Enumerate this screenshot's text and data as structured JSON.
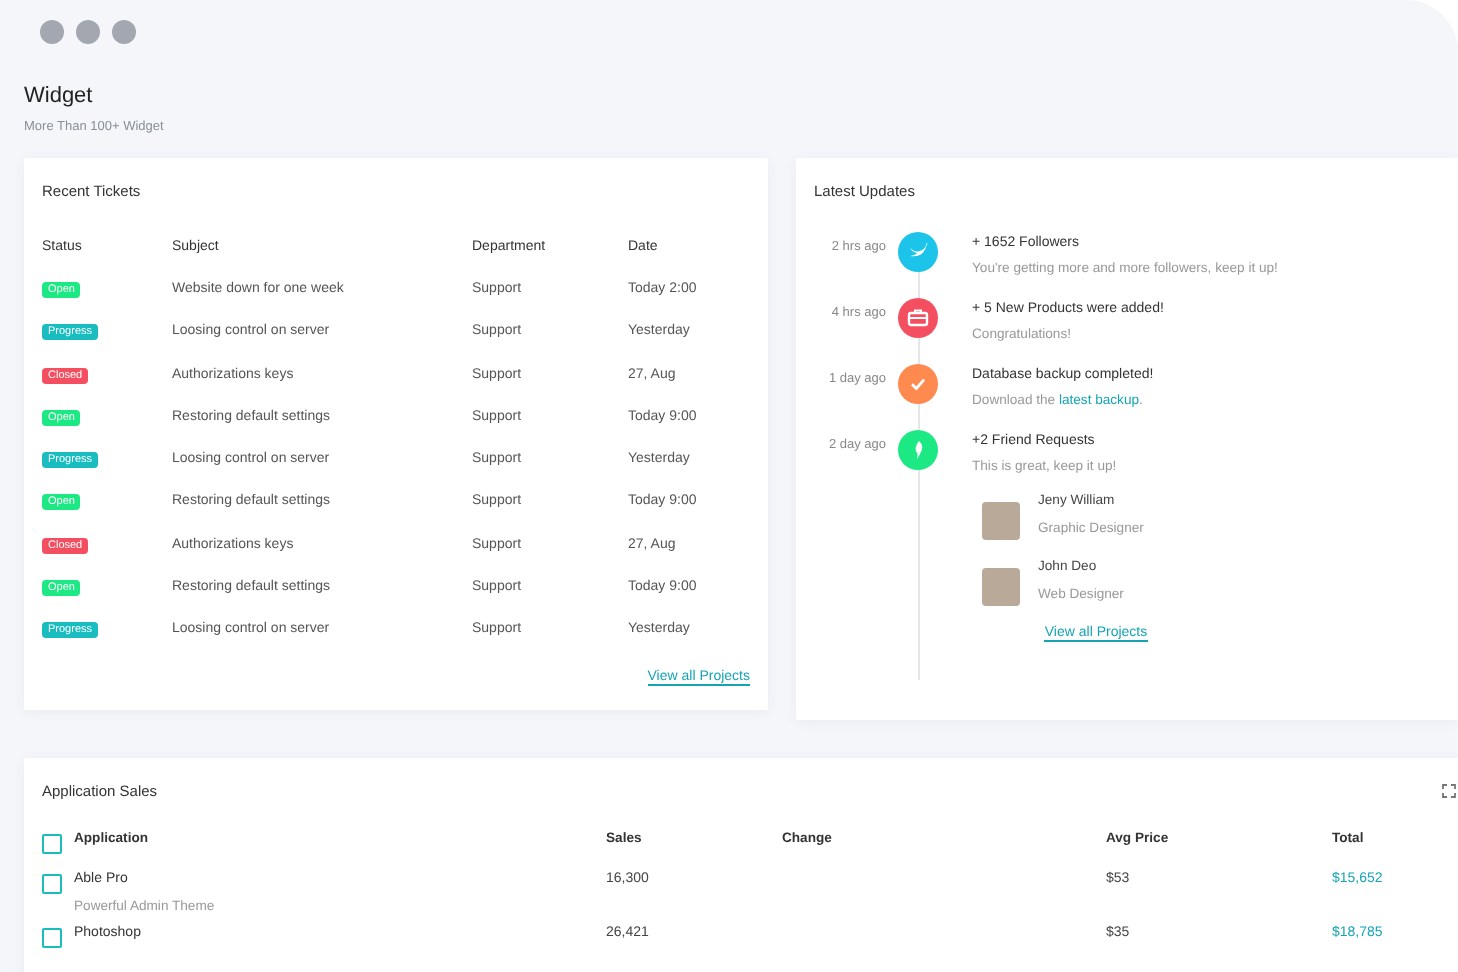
{
  "window_controls": [
    {
      "kind": "dot"
    },
    {
      "kind": "dot"
    },
    {
      "kind": "dot"
    }
  ],
  "header": {
    "title": "Widget",
    "subtitle": "More Than 100+ Widget"
  },
  "recent_tickets": {
    "title": "Recent Tickets",
    "columns": [
      "Status",
      "Subject",
      "Department",
      "Date"
    ],
    "rows": [
      {
        "status": "Open",
        "kind": "open",
        "subject": "Website down for one week",
        "department": "Support",
        "date": "Today 2:00"
      },
      {
        "status": "Progress",
        "kind": "progress",
        "subject": "Loosing control on server",
        "department": "Support",
        "date": "Yesterday"
      },
      {
        "status": "Closed",
        "kind": "closed",
        "subject": "Authorizations keys",
        "department": "Support",
        "date": "27, Aug"
      },
      {
        "status": "Open",
        "kind": "open",
        "subject": "Restoring default settings",
        "department": "Support",
        "date": "Today 9:00"
      },
      {
        "status": "Progress",
        "kind": "progress",
        "subject": "Loosing control on server",
        "department": "Support",
        "date": "Yesterday"
      },
      {
        "status": "Open",
        "kind": "open",
        "subject": "Restoring default settings",
        "department": "Support",
        "date": "Today 9:00"
      },
      {
        "status": "Closed",
        "kind": "closed",
        "subject": "Authorizations keys",
        "department": "Support",
        "date": "27, Aug"
      },
      {
        "status": "Open",
        "kind": "open",
        "subject": "Restoring default settings",
        "department": "Support",
        "date": "Today 9:00"
      },
      {
        "status": "Progress",
        "kind": "progress",
        "subject": "Loosing control on server",
        "department": "Support",
        "date": "Yesterday"
      }
    ],
    "link": "View all Projects"
  },
  "latest_updates": {
    "title": "Latest Updates",
    "items": [
      {
        "time": "2 hrs ago",
        "kind": "bird",
        "color": "#1dc4e9",
        "title": "+ 1652 Followers",
        "description": "You're getting more and more followers, keep it up!"
      },
      {
        "time": "4 hrs ago",
        "kind": "briefcase",
        "color": "#f44f60",
        "title": "+ 5 New Products were added!",
        "description": "Congratulations!"
      },
      {
        "time": "1 day ago",
        "kind": "check",
        "color": "#ff8a50",
        "title": "Database backup completed!",
        "description": "Download the",
        "link": "latest backup",
        "description_end": "."
      },
      {
        "time": "2 day ago",
        "kind": "leaf",
        "color": "#1de984",
        "title": "+2 Friend Requests",
        "description": "This is great, keep it up!",
        "friends": [
          {
            "name": "Jeny William",
            "role": "Graphic Designer"
          },
          {
            "name": "John Deo",
            "role": "Web Designer"
          }
        ]
      }
    ],
    "link": "View all Projects"
  },
  "application_sales": {
    "title": "Application Sales",
    "header_checkbox": {
      "checked": false
    },
    "columns": [
      "Application",
      "Sales",
      "Change",
      "Avg Price",
      "Total"
    ],
    "rows": [
      {
        "checked": false,
        "application": "Able Pro",
        "subtitle": "Powerful Admin Theme",
        "sales": "16,300",
        "avg_price": "$53",
        "total": "$15,652"
      },
      {
        "checked": false,
        "application": "Photoshop",
        "sales": "26,421",
        "avg_price": "$35",
        "total": "$18,785"
      }
    ]
  }
}
